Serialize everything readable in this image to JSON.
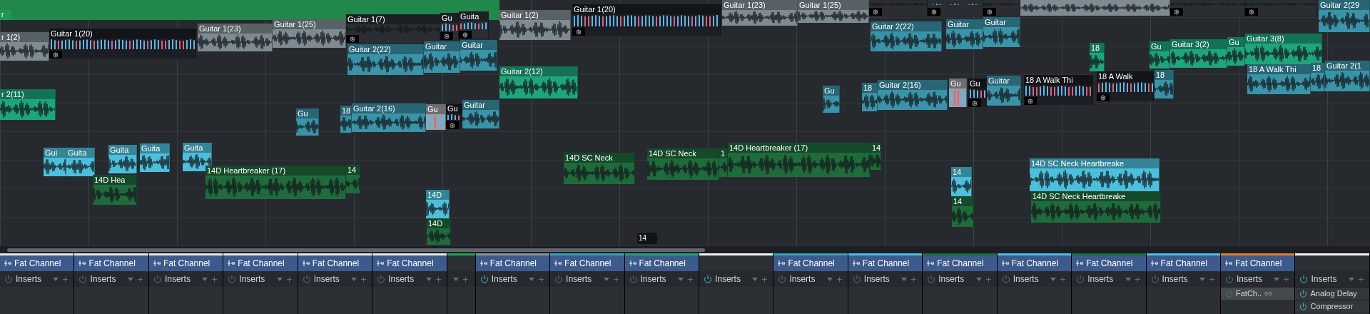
{
  "clips": [
    {
      "label": "r",
      "kind": "tag",
      "color": "#1e9a58"
    },
    {
      "label": "r 1(2)",
      "kind": "audio",
      "color": "#7f8b92",
      "gear": false
    },
    {
      "label": "Guitar 1(20)",
      "kind": "pattern",
      "color": "#1b1e22",
      "gear": true
    },
    {
      "label": "Guitar 1(23)",
      "kind": "audio",
      "color": "#7f8b92",
      "gear": false
    },
    {
      "label": "Guitar 1(25)",
      "kind": "audio",
      "color": "#7f8b92",
      "gear": false
    },
    {
      "label": "Guitar 1(7)",
      "kind": "audio",
      "color": "#2a2e33",
      "gear": true
    },
    {
      "label": "Gu",
      "kind": "pattern",
      "color": "#2a2e33",
      "gear": true
    },
    {
      "label": "Guita",
      "kind": "pattern",
      "color": "#2a2e33",
      "gear": true
    },
    {
      "label": "Guitar 1(2)",
      "kind": "audio",
      "color": "#7f8b92",
      "gear": false
    },
    {
      "label": "Guitar 1(20)",
      "kind": "pattern",
      "color": "#1b1e22",
      "gear": true
    },
    {
      "label": "Guitar 1(23)",
      "kind": "audio",
      "color": "#7f8b92",
      "gear": false
    },
    {
      "label": "Guitar 1(25)",
      "kind": "audio",
      "color": "#7f8b92",
      "gear": false
    },
    {
      "kind": "audio",
      "color": "#2a2e33",
      "gear": true
    },
    {
      "kind": "pattern",
      "color": "#2a2e33",
      "gear": true
    },
    {
      "kind": "audio",
      "color": "#2a2e33",
      "gear": true
    },
    {
      "kind": "audio",
      "color": "#7f8b92",
      "gear": false
    },
    {
      "kind": "audio",
      "color": "#2a2e33",
      "gear": true
    },
    {
      "kind": "audio",
      "color": "#2a2e33",
      "gear": true
    },
    {
      "label": "Guitar 2(29",
      "kind": "audio",
      "color": "#3a93a8",
      "gear": false
    },
    {
      "label": "Guitar 2(22)",
      "kind": "audio",
      "color": "#3a93a8",
      "gear": false
    },
    {
      "label": "Guitar",
      "kind": "audio",
      "color": "#3a93a8",
      "gear": false
    },
    {
      "label": "Guitar",
      "kind": "audio",
      "color": "#3a93a8",
      "gear": false
    },
    {
      "label": "Guitar 2(22)",
      "kind": "audio",
      "color": "#3a93a8",
      "gear": false
    },
    {
      "label": "Guitar",
      "kind": "audio",
      "color": "#3a93a8",
      "gear": false
    },
    {
      "label": "Guitar",
      "kind": "audio",
      "color": "#3a93a8",
      "gear": false
    },
    {
      "label": "r 2(11)",
      "kind": "audio",
      "color": "#1ea57c",
      "gear": false
    },
    {
      "label": "Guitar 2(12)",
      "kind": "audio",
      "color": "#1ea57c",
      "gear": false
    },
    {
      "label": "Gu",
      "kind": "audio",
      "color": "#3a93a8",
      "gear": false
    },
    {
      "label": "18",
      "kind": "audio",
      "color": "#3a93a8",
      "gear": false
    },
    {
      "label": "Guitar 2(16)",
      "kind": "audio",
      "color": "#3a93a8",
      "gear": false
    },
    {
      "label": "Gu",
      "kind": "pattern",
      "color": "#9aa0a4",
      "gear": false
    },
    {
      "label": "Gu",
      "kind": "pattern",
      "color": "#1b1e22",
      "gear": true
    },
    {
      "label": "Guitar",
      "kind": "audio",
      "color": "#3a93a8",
      "gear": false
    },
    {
      "label": "Gu",
      "kind": "audio",
      "color": "#3a93a8",
      "gear": false
    },
    {
      "label": "18",
      "kind": "audio",
      "color": "#3a93a8",
      "gear": false
    },
    {
      "label": "Guitar 2(16)",
      "kind": "audio",
      "color": "#3a93a8",
      "gear": false
    },
    {
      "label": "Gu",
      "kind": "pattern",
      "color": "#9aa0a4",
      "gear": false
    },
    {
      "label": "Gu",
      "kind": "pattern",
      "color": "#1b1e22",
      "gear": true
    },
    {
      "label": "Guitar",
      "kind": "audio",
      "color": "#3a93a8",
      "gear": false
    },
    {
      "label": "18",
      "kind": "audio",
      "color": "#1ea57c",
      "gear": false
    },
    {
      "label": "18 A Walk Thi",
      "kind": "pattern",
      "color": "#1b1e22",
      "gear": true
    },
    {
      "label": "18 A Walk",
      "kind": "pattern",
      "color": "#1b1e22",
      "gear": true
    },
    {
      "label": "Gu",
      "kind": "audio",
      "color": "#1ea57c",
      "gear": false
    },
    {
      "label": "18",
      "kind": "audio",
      "color": "#3a93a8",
      "gear": false
    },
    {
      "label": "Guitar 3(2)",
      "kind": "audio",
      "color": "#1ea57c",
      "gear": false
    },
    {
      "label": "Gu",
      "kind": "audio",
      "color": "#1ea57c",
      "gear": false
    },
    {
      "label": "Guitar 3(8)",
      "kind": "audio",
      "color": "#1ea57c",
      "gear": false
    },
    {
      "label": "18 A Walk Thi",
      "kind": "audio",
      "color": "#3a93a8",
      "gear": false
    },
    {
      "label": "18",
      "kind": "audio",
      "color": "#3a93a8",
      "gear": false
    },
    {
      "label": "Guitar 2(1",
      "kind": "audio",
      "color": "#3a93a8",
      "gear": false
    },
    {
      "label": "Gui",
      "kind": "audio",
      "color": "#4cbfdc",
      "gear": false
    },
    {
      "label": "Guita",
      "kind": "audio",
      "color": "#4cbfdc",
      "gear": false
    },
    {
      "label": "Guita",
      "kind": "audio",
      "color": "#4cbfdc",
      "gear": false
    },
    {
      "label": "Guita",
      "kind": "audio",
      "color": "#4cbfdc",
      "gear": false
    },
    {
      "label": "Guita",
      "kind": "audio",
      "color": "#4cbfdc",
      "gear": false
    },
    {
      "label": "14D Hea",
      "kind": "audio",
      "color": "#1f6b3b",
      "gear": false
    },
    {
      "label": "14D Heartbreaker (17)",
      "kind": "audio",
      "color": "#1f6b3b",
      "gear": false
    },
    {
      "label": "14",
      "kind": "audio",
      "color": "#1f6b3b",
      "gear": false
    },
    {
      "label": "14D",
      "kind": "audio",
      "color": "#4cbfdc",
      "gear": false
    },
    {
      "label": "14D",
      "kind": "audio",
      "color": "#1f6b3b",
      "gear": false
    },
    {
      "label": "14D SC Neck",
      "kind": "audio",
      "color": "#1f6b3b",
      "gear": false
    },
    {
      "label": "14D SC Neck",
      "kind": "audio",
      "color": "#1f6b3b",
      "gear": false
    },
    {
      "label": "1",
      "kind": "audio",
      "color": "#1f6b3b",
      "gear": false
    },
    {
      "label": "14D Heartbreaker (17)",
      "kind": "audio",
      "color": "#1f6b3b",
      "gear": false
    },
    {
      "label": "14",
      "kind": "audio",
      "color": "#1f6b3b",
      "gear": false
    },
    {
      "label": "14",
      "kind": "tag",
      "color": "#111316"
    },
    {
      "label": "14",
      "kind": "audio",
      "color": "#4cbfdc",
      "gear": false
    },
    {
      "label": "14",
      "kind": "audio",
      "color": "#1f6b3b",
      "gear": false
    },
    {
      "label": "14D SC Neck Heartbreake",
      "kind": "audio",
      "color": "#4cbfdc",
      "gear": false
    },
    {
      "label": "14D SC Neck Heartbreake",
      "kind": "audio",
      "color": "#1f6b3b",
      "gear": false
    }
  ],
  "mixer": {
    "strips": [
      {
        "kind": "channel",
        "color": "#e8e8e8",
        "fat_channel": "Fat Channel",
        "inserts": {
          "label": "Inserts",
          "on": false
        }
      },
      {
        "kind": "channel",
        "color": "#e8e8e8",
        "fat_channel": "Fat Channel",
        "inserts": {
          "label": "Inserts",
          "on": false
        }
      },
      {
        "kind": "channel",
        "color": "#e8e8e8",
        "fat_channel": "Fat Channel",
        "inserts": {
          "label": "Inserts",
          "on": false
        }
      },
      {
        "kind": "channel",
        "color": "#e8e8e8",
        "fat_channel": "Fat Channel",
        "inserts": {
          "label": "Inserts",
          "on": false
        }
      },
      {
        "kind": "channel",
        "color": "#e8e8e8",
        "fat_channel": "Fat Channel",
        "inserts": {
          "label": "Inserts",
          "on": false
        }
      },
      {
        "kind": "channel",
        "color": "#e8e8e8",
        "fat_channel": "Fat Channel",
        "inserts": {
          "label": "Inserts",
          "on": false
        }
      },
      {
        "kind": "narrow",
        "color": "#22a35a"
      },
      {
        "kind": "channel",
        "color": "#8a9499",
        "fat_channel": "Fat Channel",
        "inserts": {
          "label": "Inserts",
          "on": true
        }
      },
      {
        "kind": "channel",
        "color": "#3aa0b5",
        "fat_channel": "Fat Channel",
        "inserts": {
          "label": "Inserts",
          "on": false
        }
      },
      {
        "kind": "channel",
        "color": "#1ea57c",
        "fat_channel": "Fat Channel",
        "inserts": {
          "label": "Inserts",
          "on": false
        }
      },
      {
        "kind": "channel",
        "color": "#f2f2f2",
        "inserts": {
          "label": "Inserts",
          "on": true
        }
      },
      {
        "kind": "channel",
        "color": "#3aa0b5",
        "fat_channel": "Fat Channel",
        "inserts": {
          "label": "Inserts",
          "on": false
        }
      },
      {
        "kind": "channel",
        "color": "#4cbfdc",
        "fat_channel": "Fat Channel",
        "inserts": {
          "label": "Inserts",
          "on": false
        }
      },
      {
        "kind": "channel",
        "color": "#1f6b3b",
        "fat_channel": "Fat Channel",
        "inserts": {
          "label": "Inserts",
          "on": false
        }
      },
      {
        "kind": "channel",
        "color": "#4cbfdc",
        "fat_channel": "Fat Channel",
        "inserts": {
          "label": "Inserts",
          "on": false
        }
      },
      {
        "kind": "channel",
        "color": "#1f6b3b",
        "fat_channel": "Fat Channel",
        "inserts": {
          "label": "Inserts",
          "on": false
        }
      },
      {
        "kind": "channel",
        "color": "#4cbfdc",
        "fat_channel": "Fat Channel",
        "inserts": {
          "label": "Inserts",
          "on": false
        }
      },
      {
        "kind": "channel",
        "color": "#e07a30",
        "fat_channel": "Fat Channel",
        "inserts": {
          "label": "Inserts",
          "on": false
        },
        "slots": [
          {
            "label": "FatCh..",
            "on": false,
            "linked": true
          }
        ]
      },
      {
        "kind": "channel",
        "color": "#f2f2f2",
        "inserts": {
          "label": "Inserts",
          "on": true
        },
        "slots": [
          {
            "label": "Analog Delay",
            "on": true,
            "linked": false
          },
          {
            "label": "Compressor",
            "on": true,
            "linked": false
          }
        ]
      }
    ]
  }
}
